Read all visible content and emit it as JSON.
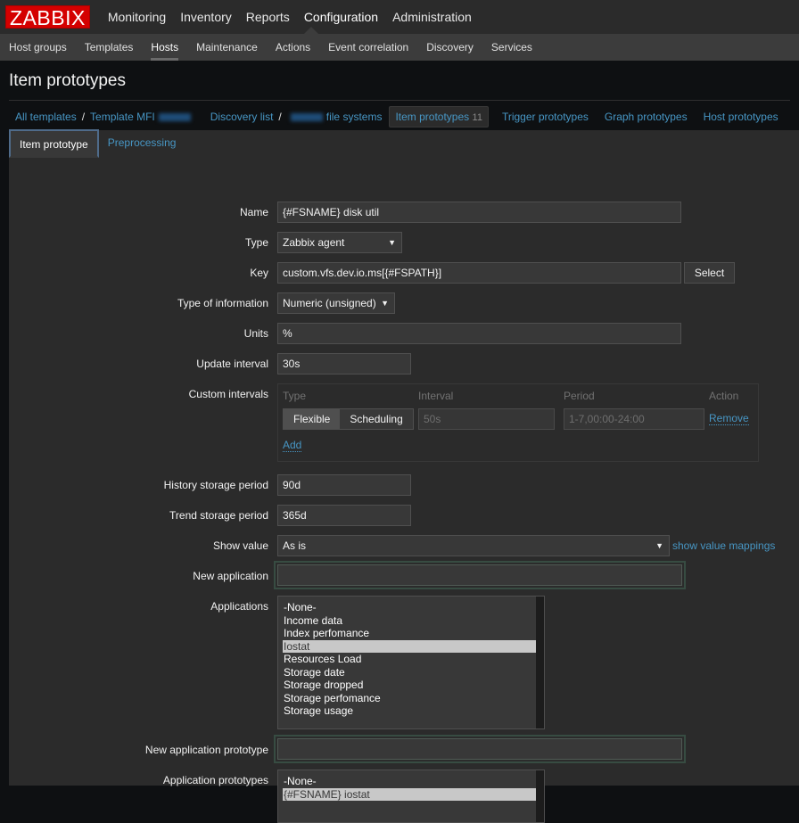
{
  "logo": "ZABBIX",
  "main_nav": [
    "Monitoring",
    "Inventory",
    "Reports",
    "Configuration",
    "Administration"
  ],
  "main_nav_active": "Configuration",
  "sub_nav": [
    "Host groups",
    "Templates",
    "Hosts",
    "Maintenance",
    "Actions",
    "Event correlation",
    "Discovery",
    "Services"
  ],
  "sub_nav_active": "Hosts",
  "page_title": "Item prototypes",
  "breadcrumbs": {
    "all_templates": "All templates",
    "template": "Template MFI",
    "discovery_list": "Discovery list",
    "discovery_rule_suffix": "file systems",
    "item_prototypes": "Item prototypes",
    "item_prototypes_count": "11",
    "trigger_prototypes": "Trigger prototypes",
    "graph_prototypes": "Graph prototypes",
    "host_prototypes": "Host prototypes"
  },
  "tabs": [
    "Item prototype",
    "Preprocessing"
  ],
  "tabs_active": "Item prototype",
  "form": {
    "name": {
      "label": "Name",
      "value": "{#FSNAME} disk util"
    },
    "type": {
      "label": "Type",
      "value": "Zabbix agent"
    },
    "key": {
      "label": "Key",
      "value": "custom.vfs.dev.io.ms[{#FSPATH}]",
      "button": "Select"
    },
    "type_of_information": {
      "label": "Type of information",
      "value": "Numeric (unsigned)"
    },
    "units": {
      "label": "Units",
      "value": "%"
    },
    "update_interval": {
      "label": "Update interval",
      "value": "30s"
    },
    "custom_intervals": {
      "label": "Custom intervals",
      "headers": [
        "Type",
        "Interval",
        "Period",
        "Action"
      ],
      "rows": [
        {
          "type_options": [
            "Flexible",
            "Scheduling"
          ],
          "type_selected": "Flexible",
          "interval_placeholder": "50s",
          "period_placeholder": "1-7,00:00-24:00",
          "action": "Remove"
        }
      ],
      "add": "Add"
    },
    "history_storage_period": {
      "label": "History storage period",
      "value": "90d"
    },
    "trend_storage_period": {
      "label": "Trend storage period",
      "value": "365d"
    },
    "show_value": {
      "label": "Show value",
      "value": "As is",
      "link": "show value mappings"
    },
    "new_application": {
      "label": "New application",
      "value": ""
    },
    "applications": {
      "label": "Applications",
      "options": [
        "-None-",
        "Income data",
        "Index perfomance",
        "Iostat",
        "Resources Load",
        "Storage date",
        "Storage dropped",
        "Storage perfomance",
        "Storage usage"
      ],
      "selected": "Iostat"
    },
    "new_application_prototype": {
      "label": "New application prototype",
      "value": ""
    },
    "application_prototypes": {
      "label": "Application prototypes",
      "options": [
        "-None-",
        "{#FSNAME} iostat"
      ],
      "selected": "{#FSNAME} iostat"
    }
  }
}
